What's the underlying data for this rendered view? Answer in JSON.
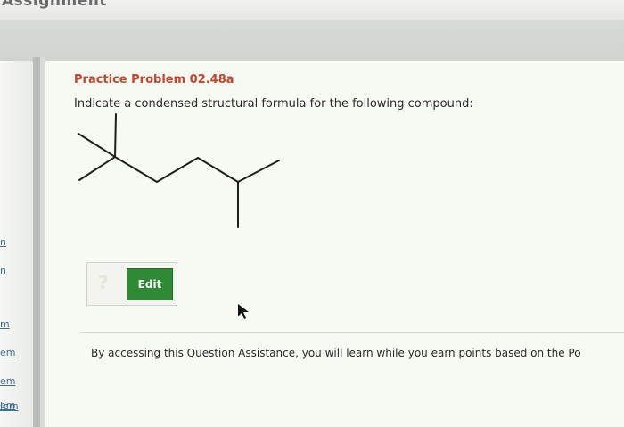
{
  "header": {
    "title": "Assignment"
  },
  "sidebar": {
    "links": [
      {
        "label": "n"
      },
      {
        "label": "n"
      },
      {
        "label": "m"
      },
      {
        "label": "em"
      },
      {
        "label": "em"
      },
      {
        "label": "em"
      },
      {
        "label": "lem"
      }
    ]
  },
  "problem": {
    "title": "Practice Problem 02.48a",
    "instruction": "Indicate a condensed structural formula for the following compound:"
  },
  "toolbar": {
    "help_icon": "?",
    "edit_label": "Edit"
  },
  "assistance": {
    "text": "By accessing this Question Assistance, you will learn while you earn points based on the Po"
  },
  "colors": {
    "title": "#c2452d",
    "edit_button": "#2f8a34",
    "link": "#3e6f8e"
  }
}
